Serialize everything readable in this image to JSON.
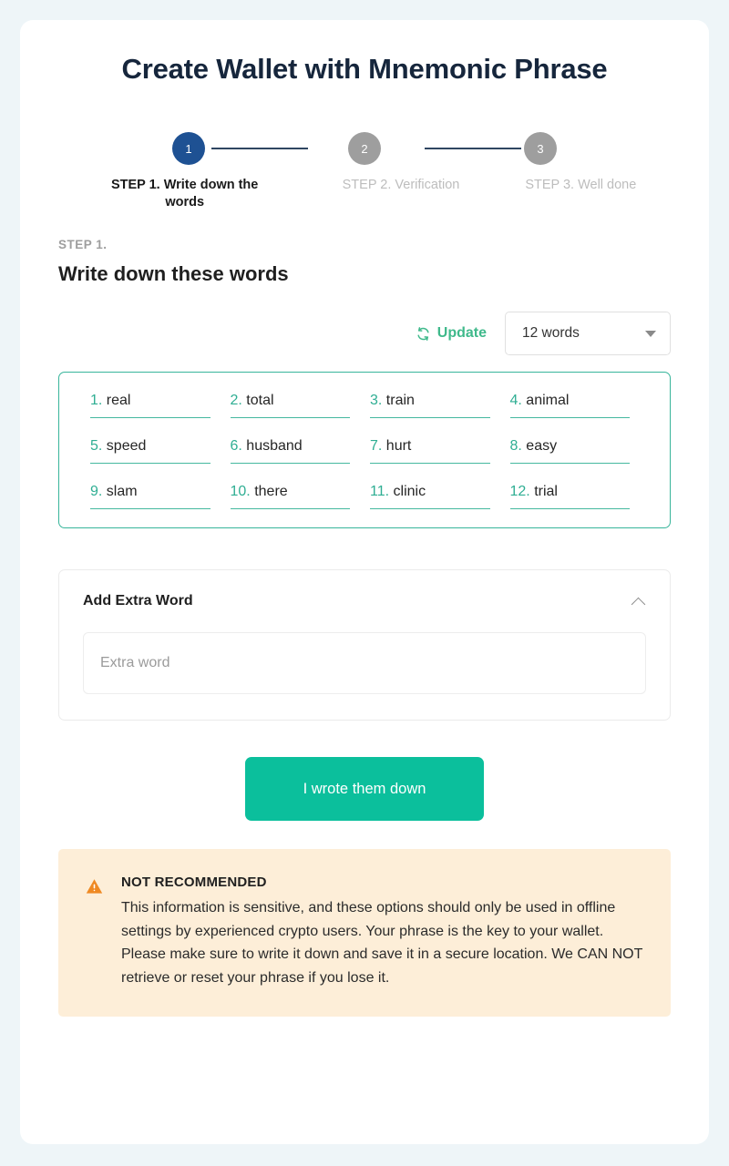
{
  "page": {
    "title": "Create Wallet with Mnemonic Phrase",
    "background_color": "#eef5f8",
    "card_color": "#ffffff"
  },
  "stepper": {
    "steps": [
      {
        "number": "1",
        "label": "STEP 1. Write down the words",
        "state": "active",
        "color": "#1e5193"
      },
      {
        "number": "2",
        "label": "STEP 2. Verification",
        "state": "inactive",
        "color": "#9e9e9e"
      },
      {
        "number": "3",
        "label": "STEP 3. Well done",
        "state": "inactive",
        "color": "#9e9e9e"
      }
    ]
  },
  "section": {
    "kicker": "STEP 1.",
    "title": "Write down these words"
  },
  "controls": {
    "update_label": "Update",
    "update_icon": "refresh-icon",
    "update_color": "#3fb98b",
    "word_count_value": "12 words",
    "caret_icon": "chevron-down-icon"
  },
  "mnemonic": {
    "border_color": "#38b59b",
    "number_color": "#2fae93",
    "words": [
      {
        "index": "1.",
        "word": "real"
      },
      {
        "index": "2.",
        "word": "total"
      },
      {
        "index": "3.",
        "word": "train"
      },
      {
        "index": "4.",
        "word": "animal"
      },
      {
        "index": "5.",
        "word": "speed"
      },
      {
        "index": "6.",
        "word": "husband"
      },
      {
        "index": "7.",
        "word": "hurt"
      },
      {
        "index": "8.",
        "word": "easy"
      },
      {
        "index": "9.",
        "word": "slam"
      },
      {
        "index": "10.",
        "word": "there"
      },
      {
        "index": "11.",
        "word": "clinic"
      },
      {
        "index": "12.",
        "word": "trial"
      }
    ]
  },
  "extra_word": {
    "title": "Add Extra Word",
    "toggle_icon": "chevron-up-icon",
    "input_value": "",
    "input_placeholder": "Extra word"
  },
  "cta": {
    "label": "I wrote them down",
    "color": "#0bbf9c"
  },
  "warning": {
    "icon": "warning-triangle-icon",
    "icon_color": "#ef8922",
    "background_color": "#fdeed8",
    "title": "NOT RECOMMENDED",
    "body": "This information is sensitive, and these options should only be used in offline settings by experienced crypto users. Your phrase is the key to your wallet. Please make sure to write it down and save it in a secure location. We CAN NOT retrieve or reset your phrase if you lose it."
  }
}
